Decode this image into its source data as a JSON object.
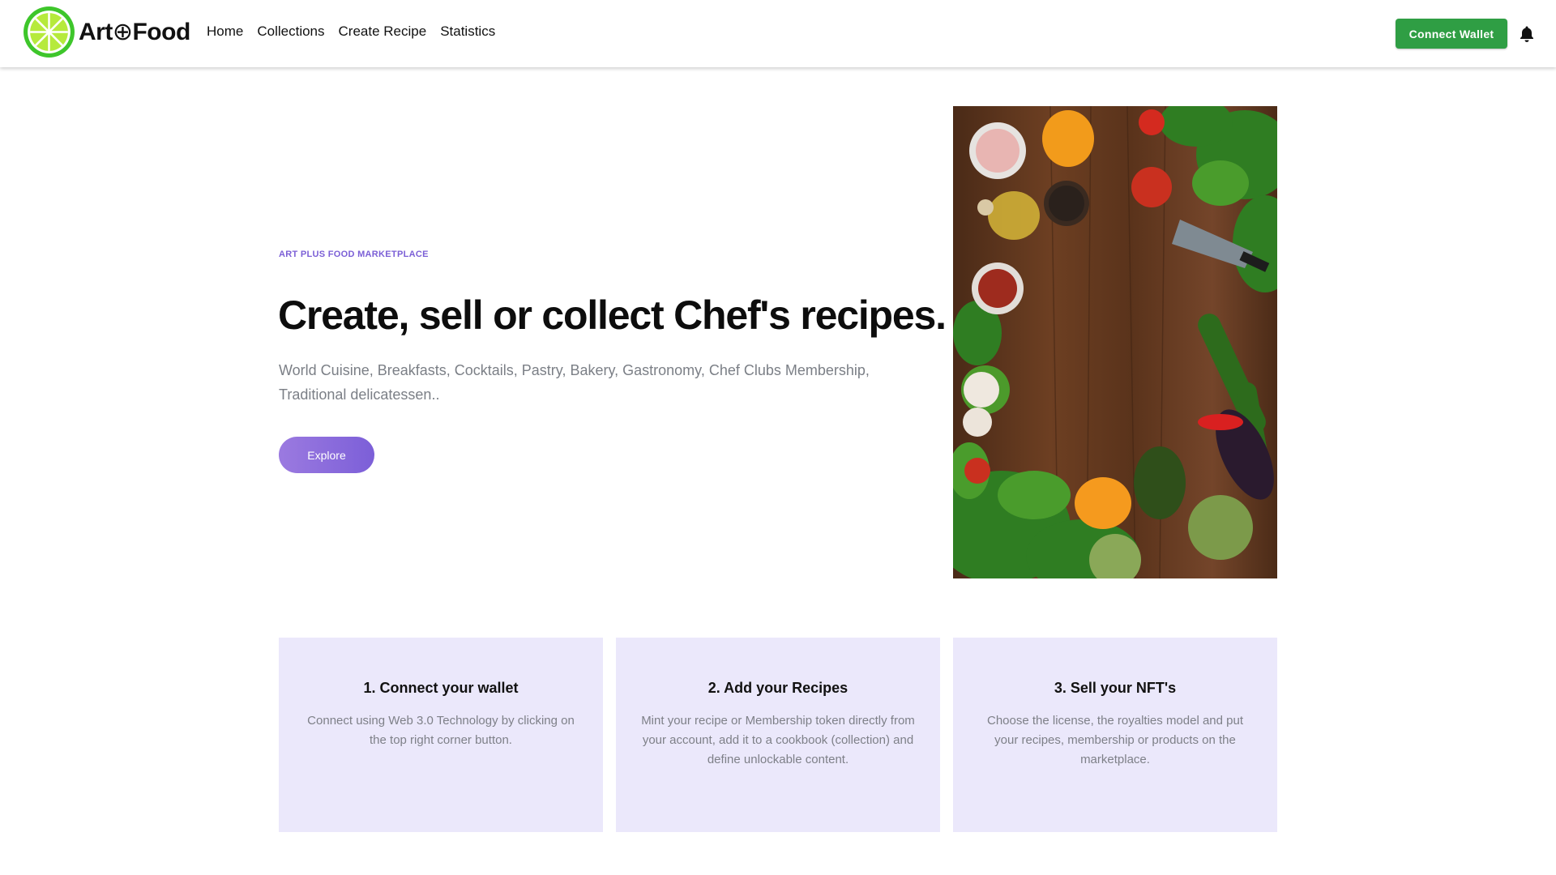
{
  "header": {
    "brand": {
      "name_prefix": "Art",
      "plus_symbol": "⊕",
      "name_suffix": "Food"
    },
    "nav": [
      {
        "label": "Home"
      },
      {
        "label": "Collections"
      },
      {
        "label": "Create Recipe"
      },
      {
        "label": "Statistics"
      }
    ],
    "connect_wallet_label": "Connect Wallet",
    "notification_icon": "bell-icon"
  },
  "hero": {
    "eyebrow": "ART PLUS FOOD MARKETPLACE",
    "title": "Create, sell or collect Chef's recipes.",
    "subtitle": "World Cuisine, Breakfasts, Cocktails, Pastry, Bakery, Gastronomy, Chef Clubs Membership, Traditional delicatessen..",
    "explore_label": "Explore",
    "image": "vegetables-on-wooden-board"
  },
  "steps": [
    {
      "title": "1. Connect your wallet",
      "text": "Connect using Web 3.0 Technology by clicking on the top right corner button."
    },
    {
      "title": "2. Add your Recipes",
      "text": "Mint your recipe or Membership token directly from your account, add it to a cookbook (collection) and define unlockable content."
    },
    {
      "title": "3. Sell your NFT's",
      "text": "Choose the license, the royalties model and put your recipes, membership or products on the marketplace."
    }
  ],
  "colors": {
    "accent": "#7c5fd8",
    "connect_green": "#2f9e44",
    "step_bg": "#ebe8fb",
    "logo_green": "#3ec62b",
    "logo_lime": "#b6ea3c"
  }
}
